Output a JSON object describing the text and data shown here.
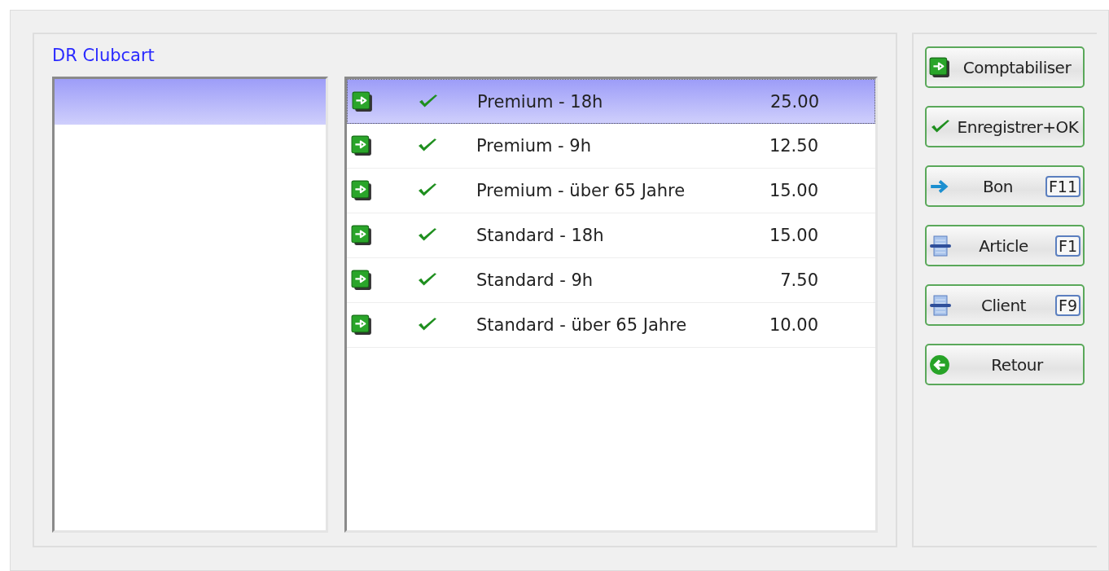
{
  "panel": {
    "title": "DR  Clubcart"
  },
  "category_list": {
    "items": [
      {
        "selected": true
      }
    ]
  },
  "tariff_list": {
    "rows": [
      {
        "selected": true,
        "checked": true,
        "label": "Premium - 18h",
        "price": "25.00"
      },
      {
        "selected": false,
        "checked": true,
        "label": "Premium - 9h",
        "price": "12.50"
      },
      {
        "selected": false,
        "checked": true,
        "label": "Premium - über 65 Jahre",
        "price": "15.00"
      },
      {
        "selected": false,
        "checked": true,
        "label": "Standard - 18h",
        "price": "15.00"
      },
      {
        "selected": false,
        "checked": true,
        "label": "Standard - 9h",
        "price": "7.50"
      },
      {
        "selected": false,
        "checked": true,
        "label": "Standard - über 65 Jahre",
        "price": "10.00"
      }
    ]
  },
  "buttons": [
    {
      "kind": "post",
      "label": "Comptabiliser"
    },
    {
      "kind": "check",
      "label": "Enregistrer+OK"
    },
    {
      "kind": "arrow",
      "label": "Bon",
      "shortcut": "F11"
    },
    {
      "kind": "scanner",
      "label": "Article",
      "shortcut": "F1"
    },
    {
      "kind": "scanner",
      "label": "Client",
      "shortcut": "F9"
    },
    {
      "kind": "back",
      "label": "Retour"
    }
  ]
}
